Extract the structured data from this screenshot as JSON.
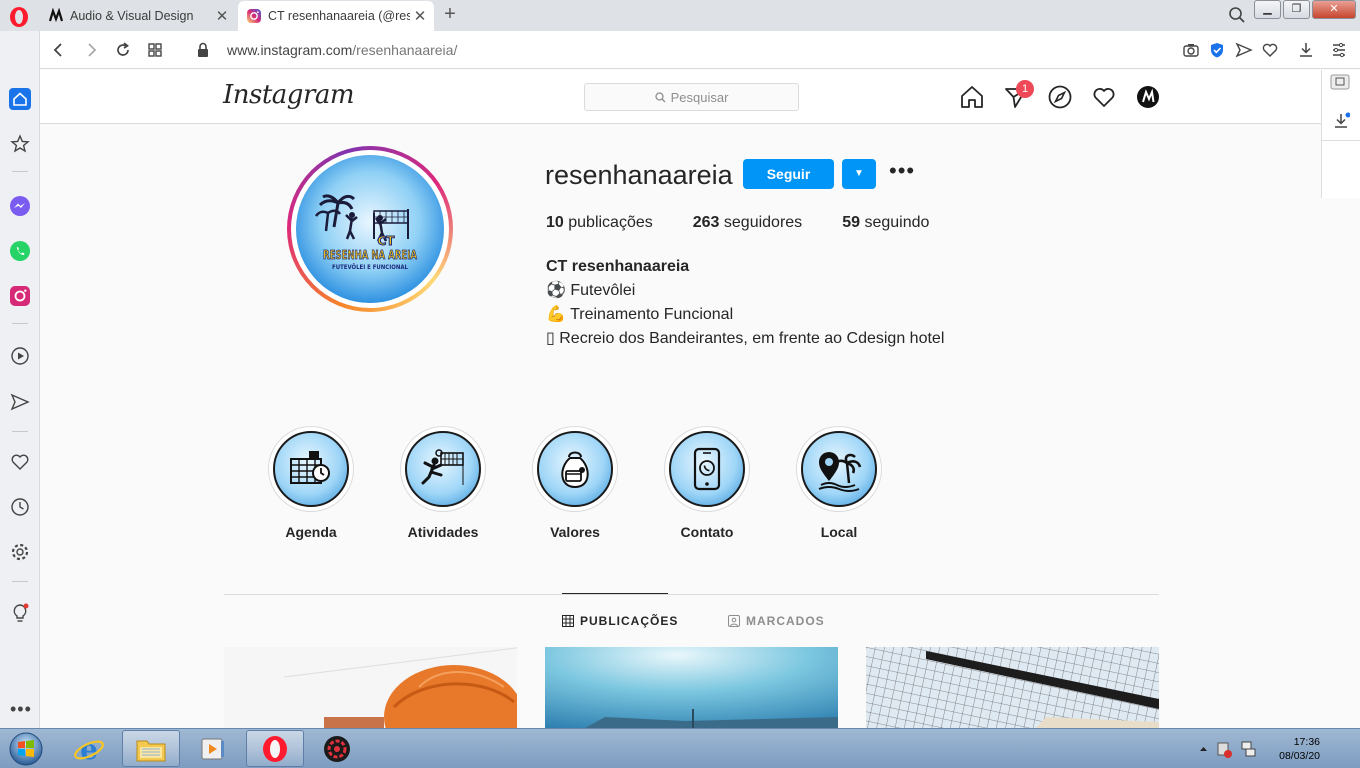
{
  "browser": {
    "tabs": [
      {
        "title": "Audio & Visual Design",
        "active": false
      },
      {
        "title": "CT resenhanaareia (@resen",
        "active": true
      }
    ],
    "url_host": "www.instagram.com",
    "url_path": "/resenhanaareia/"
  },
  "instagram": {
    "logo": "Instagram",
    "search_placeholder": "Pesquisar",
    "notification_count": "1"
  },
  "profile": {
    "username": "resenhanaareia",
    "follow_label": "Seguir",
    "stats": {
      "posts_count": "10",
      "posts_label": "publicações",
      "followers_count": "263",
      "followers_label": "seguidores",
      "following_count": "59",
      "following_label": "seguindo"
    },
    "bio": {
      "name": "CT resenhanaareia",
      "line1": "⚽ Futevôlei",
      "line2": "💪 Treinamento Funcional",
      "line3": "▯ Recreio dos Bandeirantes, em frente ao Cdesign hotel"
    },
    "avatar_text": {
      "top": "CT",
      "main": "RESENHA NA AREIA",
      "sub": "FUTEVÔLEI E FUNCIONAL"
    }
  },
  "highlights": [
    {
      "label": "Agenda"
    },
    {
      "label": "Atividades"
    },
    {
      "label": "Valores"
    },
    {
      "label": "Contato"
    },
    {
      "label": "Local"
    }
  ],
  "profile_tabs": {
    "posts": "PUBLICAÇÕES",
    "tagged": "MARCADOS"
  },
  "taskbar": {
    "time": "17:36",
    "date": "08/03/20"
  },
  "colors": {
    "accent": "#0095f6",
    "badge": "#ed4956"
  }
}
